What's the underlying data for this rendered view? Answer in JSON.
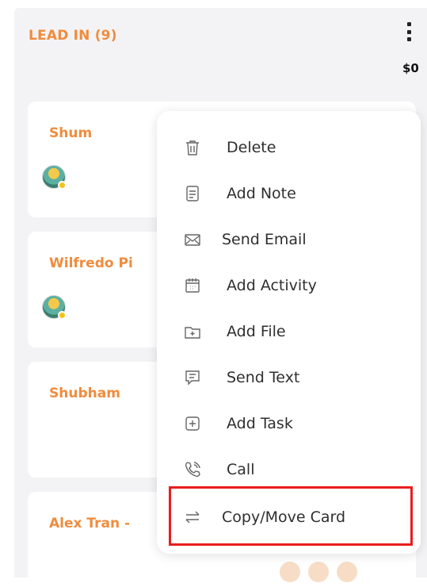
{
  "column": {
    "title": "LEAD IN (9)",
    "total": "$0"
  },
  "cards": [
    {
      "name": "Shum",
      "has_avatar": true
    },
    {
      "name": "Wilfredo Pi",
      "has_avatar": true
    },
    {
      "name": "Shubham",
      "has_avatar": false
    },
    {
      "name": "Alex Tran -",
      "has_avatar": false
    }
  ],
  "menu": {
    "items": [
      {
        "label": "Delete",
        "icon": "trash-icon"
      },
      {
        "label": "Add Note",
        "icon": "note-icon"
      },
      {
        "label": "Send Email",
        "icon": "envelope-icon"
      },
      {
        "label": "Add Activity",
        "icon": "calendar-icon"
      },
      {
        "label": "Add File",
        "icon": "folder-add-icon"
      },
      {
        "label": "Send Text",
        "icon": "message-icon"
      },
      {
        "label": "Add Task",
        "icon": "plus-square-icon"
      },
      {
        "label": "Call",
        "icon": "phone-icon"
      },
      {
        "label": "Copy/Move Card",
        "icon": "swap-arrows-icon"
      }
    ]
  },
  "colors": {
    "accent": "#ef8c3e",
    "highlight": "#ea1d1d",
    "column_bg": "#f3f3f5"
  }
}
